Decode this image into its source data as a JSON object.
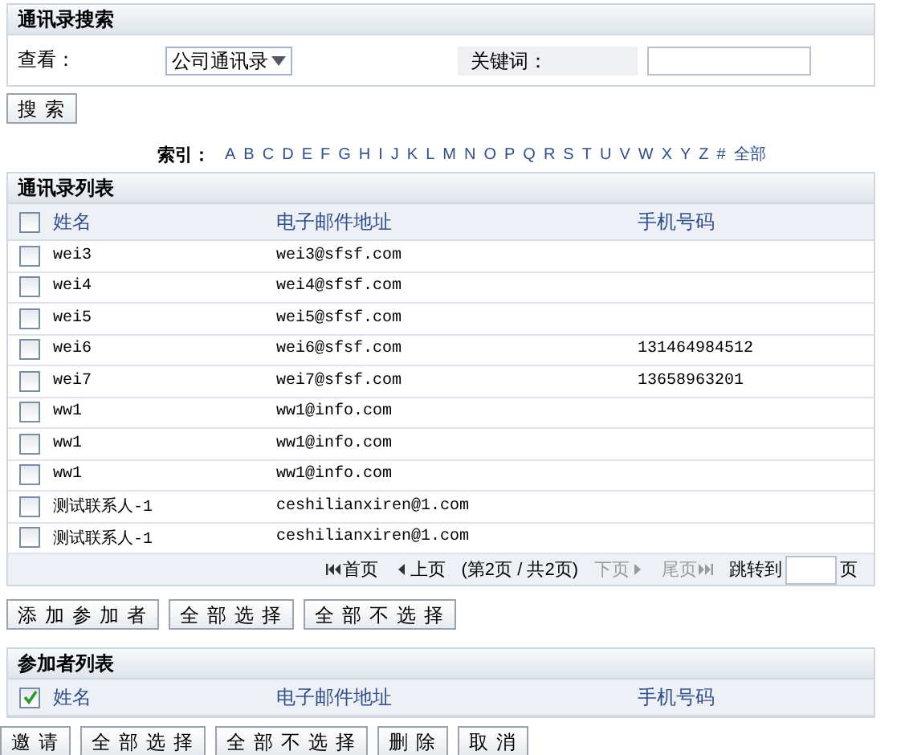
{
  "search_panel": {
    "title": "通讯录搜索",
    "view_label": "查看：",
    "view_select": "公司通讯录",
    "keyword_label": "关键词："
  },
  "search_button": "搜索",
  "index": {
    "label": "索引：",
    "letters": [
      "A",
      "B",
      "C",
      "D",
      "E",
      "F",
      "G",
      "H",
      "I",
      "J",
      "K",
      "L",
      "M",
      "N",
      "O",
      "P",
      "Q",
      "R",
      "S",
      "T",
      "U",
      "V",
      "W",
      "X",
      "Y",
      "Z",
      "#",
      "全部"
    ]
  },
  "contact_list": {
    "title": "通讯录列表",
    "header_checked": false,
    "columns": [
      "姓名",
      "电子邮件地址",
      "手机号码"
    ],
    "rows": [
      {
        "name": "wei3",
        "email": "wei3@sfsf.com",
        "checked": false
      },
      {
        "name": "wei4",
        "email": "wei4@sfsf.com",
        "checked": false
      },
      {
        "name": "wei5",
        "email": "wei5@sfsf.com",
        "checked": false
      },
      {
        "name": "wei6",
        "email": "wei6@sfsf.com",
        "phone": "131464984512",
        "checked": false
      },
      {
        "name": "wei7",
        "email": "wei7@sfsf.com",
        "phone": "13658963201",
        "checked": false
      },
      {
        "name": "ww1",
        "email": "ww1@info.com",
        "checked": false
      },
      {
        "name": "ww1",
        "email": "ww1@info.com",
        "checked": false
      },
      {
        "name": "ww1",
        "email": "ww1@info.com",
        "checked": false
      },
      {
        "name": "测试联系人-1",
        "email": "ceshilianxiren@1.com",
        "checked": false
      },
      {
        "name": "测试联系人-1",
        "email": "ceshilianxiren@1.com",
        "checked": false
      }
    ],
    "pagination": {
      "items": [
        {
          "label": "首页",
          "disabled": false
        },
        {
          "label": "上页",
          "disabled": false
        }
      ],
      "status": "(第2页 / 共2页)",
      "items_after": [
        {
          "label": "下页",
          "disabled": true
        },
        {
          "label": "尾页",
          "disabled": true
        }
      ],
      "jump_label": "跳转到",
      "page_suffix": "页"
    }
  },
  "contact_buttons": [
    "添加参加者",
    "全部选择",
    "全部不选择"
  ],
  "participant_list": {
    "title": "参加者列表",
    "header_checked": true,
    "columns": [
      "姓名",
      "电子邮件地址",
      "手机号码"
    ]
  },
  "participant_buttons": [
    "邀请",
    "全部选择",
    "全部不选择",
    "删除",
    "取消"
  ]
}
